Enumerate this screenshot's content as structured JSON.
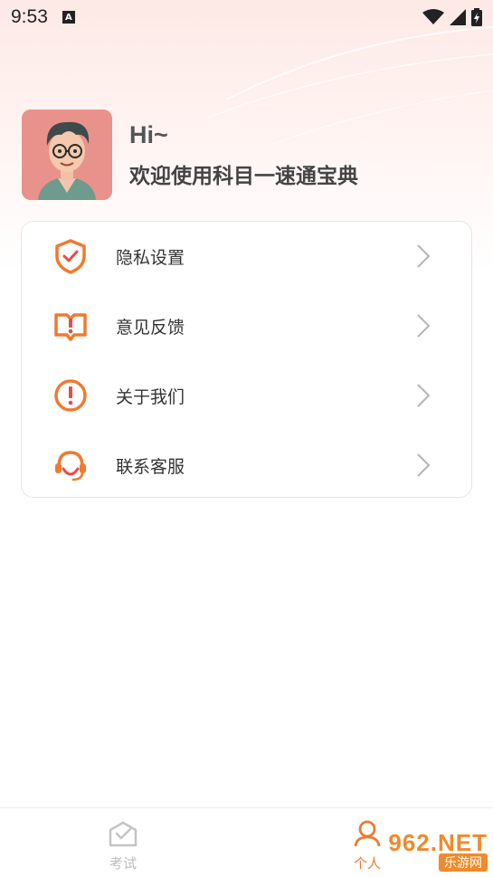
{
  "status_bar": {
    "time": "9:53",
    "a_badge": "A"
  },
  "profile": {
    "greeting": "Hi~",
    "welcome": "欢迎使用科目一速通宝典"
  },
  "menu": [
    {
      "label": "隐私设置",
      "icon": "shield-check-icon"
    },
    {
      "label": "意见反馈",
      "icon": "feedback-book-icon"
    },
    {
      "label": "关于我们",
      "icon": "info-exclamation-icon"
    },
    {
      "label": "联系客服",
      "icon": "headset-icon"
    }
  ],
  "tabbar": {
    "tabs": [
      {
        "label": "考试",
        "icon": "exam-envelope-icon",
        "active": false
      },
      {
        "label": "个人",
        "icon": "person-icon",
        "active": true
      }
    ]
  },
  "watermark": {
    "big": "962.NET",
    "small": "乐游网"
  },
  "colors": {
    "accent": "#ef7a30",
    "inactive": "#bdbdbd",
    "text": "#333333"
  }
}
